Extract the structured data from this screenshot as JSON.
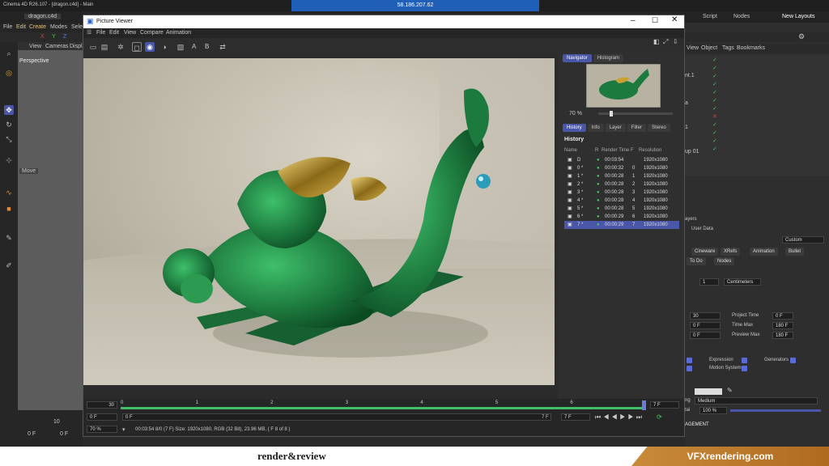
{
  "system": {
    "app_title": "Cinema 4D R26.107 - [dragon.c4d] - Main",
    "remote_ip": "58.186.207.62"
  },
  "c4d": {
    "doc_tab": "dragon.c4d",
    "menu": [
      "File",
      "Edit",
      "Create",
      "Modes",
      "Sele"
    ],
    "view_menu": [
      "View",
      "Cameras",
      "Displ"
    ],
    "right_tabs": {
      "script": "Script",
      "nodes": "Nodes",
      "layouts": "New Layouts"
    },
    "viewport_label": "Perspective",
    "move_label": "Move",
    "left_fields": {
      "f1": "0 F",
      "f2": "0 F",
      "ten": "10"
    }
  },
  "pv": {
    "title": "Picture Viewer",
    "menu": [
      "File",
      "Edit",
      "View",
      "Compare",
      "Animation"
    ],
    "toolbar_letters": [
      "A",
      "B"
    ],
    "panel_tabs": [
      "Navigator",
      "Histogram"
    ],
    "zoom": "70 %",
    "info_tabs": [
      "History",
      "Info",
      "Layer",
      "Filter",
      "Stereo"
    ],
    "history_title": "History",
    "history_cols": [
      "Name",
      "R",
      "Render Time",
      "F",
      "Resolution"
    ],
    "history": [
      {
        "name": "D",
        "time": "00:03:54",
        "frame": "",
        "res": "1920x1080"
      },
      {
        "name": "0 *",
        "time": "00:00:32",
        "frame": "0",
        "res": "1920x1080"
      },
      {
        "name": "1 *",
        "time": "00:00:28",
        "frame": "1",
        "res": "1920x1080"
      },
      {
        "name": "2 *",
        "time": "00:00:28",
        "frame": "2",
        "res": "1920x1080"
      },
      {
        "name": "3 *",
        "time": "00:00:28",
        "frame": "3",
        "res": "1920x1080"
      },
      {
        "name": "4 *",
        "time": "00:00:28",
        "frame": "4",
        "res": "1920x1080"
      },
      {
        "name": "5 *",
        "time": "00:00:28",
        "frame": "5",
        "res": "1920x1080"
      },
      {
        "name": "6 *",
        "time": "00:00:29",
        "frame": "6",
        "res": "1920x1080"
      },
      {
        "name": "7 *",
        "time": "00:00:29",
        "frame": "7",
        "res": "1920x1080"
      }
    ],
    "timeline": {
      "start_field": "30",
      "ticks": [
        "0",
        "1",
        "2",
        "3",
        "4",
        "5",
        "6"
      ],
      "end_field": "7 F",
      "left_field": "0 F",
      "mid_field": "0 F",
      "frame_a": "7 F",
      "frame_b": "7 F",
      "zoom": "70 %",
      "status": "00:03:54 8/0 (7 F)    Size: 1920x1080, RGB (32 Bit), 23.96 MB, ( F 8 of 8 )"
    }
  },
  "rightpanel": {
    "obj_tabs": [
      "View",
      "Object",
      "Tags",
      "Bookmarks"
    ],
    "side_labels": [
      "nt.1",
      "a",
      "1",
      "up 01"
    ],
    "attr": {
      "layers": "ayers",
      "user_data": "User Data",
      "custom": "Custom",
      "buttons": [
        "Cineware",
        "XRefs",
        "Animation",
        "Bullet",
        "To Do",
        "Nodes"
      ],
      "scale_value": "1",
      "units": "Centimeters",
      "fps": "30",
      "project_time_label": "Project Time",
      "project_time": "0 F",
      "min": "0 F",
      "time_max_label": "Time Max",
      "time_max": "180 F",
      "pmin": "0 F",
      "preview_max_label": "Preview Max",
      "preview_max": "180 F",
      "expression": "Expression",
      "generators": "Generators",
      "motion_system": "Motion System",
      "medium": "Medium",
      "ng": "ng",
      "percent": "100 %",
      "tai": "tai",
      "management": "AGEMENT"
    }
  },
  "footer": {
    "left_brand": "render&review",
    "right_brand": "VFXrendering.com"
  },
  "colors": {
    "accent": "#4a56a8",
    "vfx": "#c07a2b",
    "dragon": "#1d7a3e",
    "gold": "#c9a233",
    "pass": "#3fcf5a"
  }
}
